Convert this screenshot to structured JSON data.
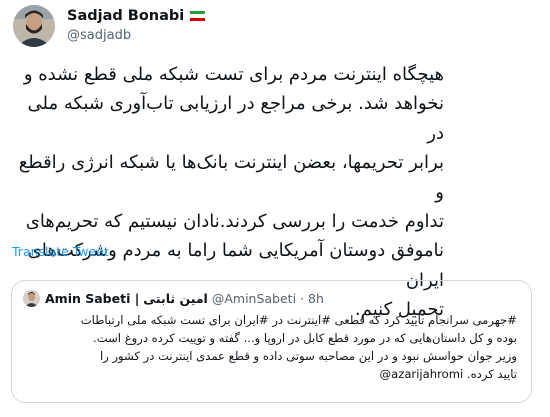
{
  "author": {
    "display_name": "Sadjad Bonabi",
    "handle": "@sadjadb",
    "flag_colors": [
      "#239f40",
      "#ffffff",
      "#da0000"
    ]
  },
  "tweet": {
    "lines": [
      "هیچگاه اینترنت مردم برای تست شبکه ملی قطع نشده و",
      "نخواهد شد. برخی مراجع در ارزیابی تاب‌آوری شبکه ملی در",
      "برابر تحریمها، بعضن اینترنت بانک‌ها یا شبکه انرژی راقطع و",
      "تداوم خدمت را بررسی کردند.نادان نیستیم که تحریم‌های",
      "ناموفق دوستان آمریکایی شما راما به مردم وشرکت‌های ایران",
      "تحمیل کنیم."
    ]
  },
  "translate_label": "Translate Tweet",
  "quoted": {
    "name": "Amin Sabeti |",
    "name_fa": "امین ثابتی",
    "handle": "@AminSabeti",
    "dot": "·",
    "time": "8h",
    "lines": [
      "#جهرمی سرانجام تایید کرد که قطعی #اینترنت در #ایران برای تست شبکه ملی ارتباطات",
      "بوده و کل داستان‌هایی که در مورد قطع کابل در اروپا و... گفته و توییت کرده دروغ است.",
      "وزیر جوان حواسش نبود و در این مصاحبه سوتی داده و قطع عمدی اینترنت در کشور را",
      "تایید کرده. azarijahromi@"
    ]
  },
  "colors": {
    "link": "#1d9bf0",
    "text": "#0f1419",
    "secondary": "#536471",
    "border": "#cfd9de"
  }
}
